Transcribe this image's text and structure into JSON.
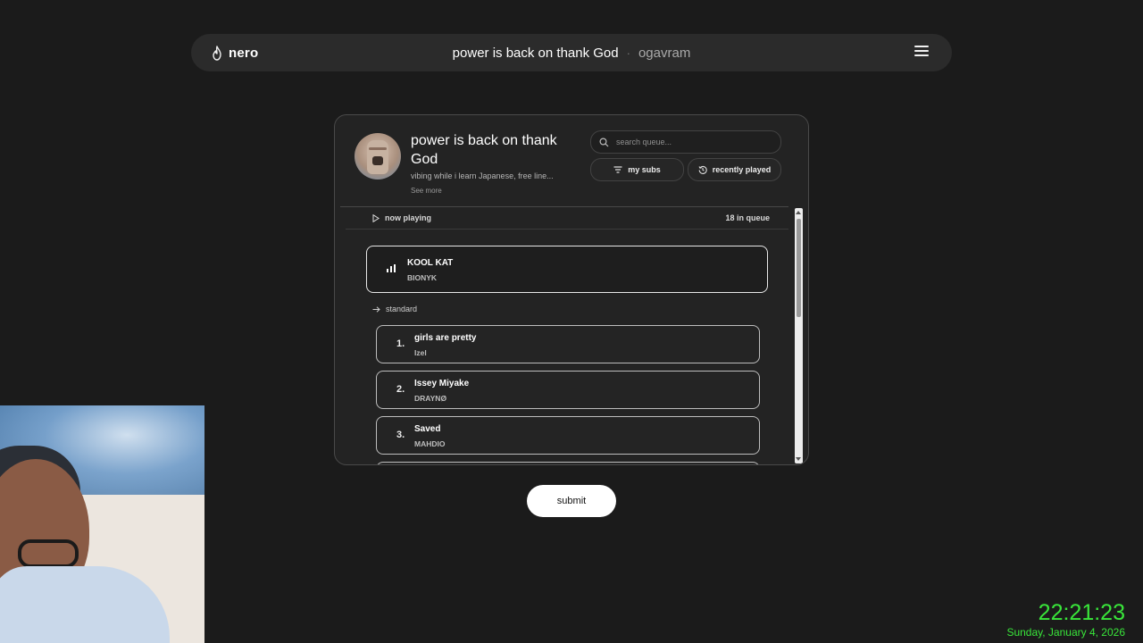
{
  "topbar": {
    "brand": "nero",
    "stream_title": "power is back on thank God",
    "separator": "·",
    "username": "ogavram",
    "menu_icon": "hamburger-menu-icon"
  },
  "queue_card": {
    "title": "power is back on thank God",
    "description": "vibing while i learn Japanese, free line...",
    "see_more": "See more",
    "search_placeholder": "search queue...",
    "filter_subs_label": "my subs",
    "recently_played_label": "recently played",
    "now_playing_label": "now playing",
    "queue_count": "18 in queue",
    "current_track": {
      "title": "KOOL KAT",
      "artist": "BIONYK"
    },
    "section_label": "standard",
    "items": [
      {
        "num": "1.",
        "title": "girls are pretty",
        "artist": "Izel"
      },
      {
        "num": "2.",
        "title": "Issey Miyake",
        "artist": "DRAYNØ"
      },
      {
        "num": "3.",
        "title": "Saved",
        "artist": "MAHDIO"
      }
    ]
  },
  "submit_label": "submit",
  "clock": {
    "time": "22:21:23",
    "date": "Sunday, January 4, 2026"
  },
  "colors": {
    "background": "#1b1b1b",
    "clock_green": "#39e63a"
  }
}
